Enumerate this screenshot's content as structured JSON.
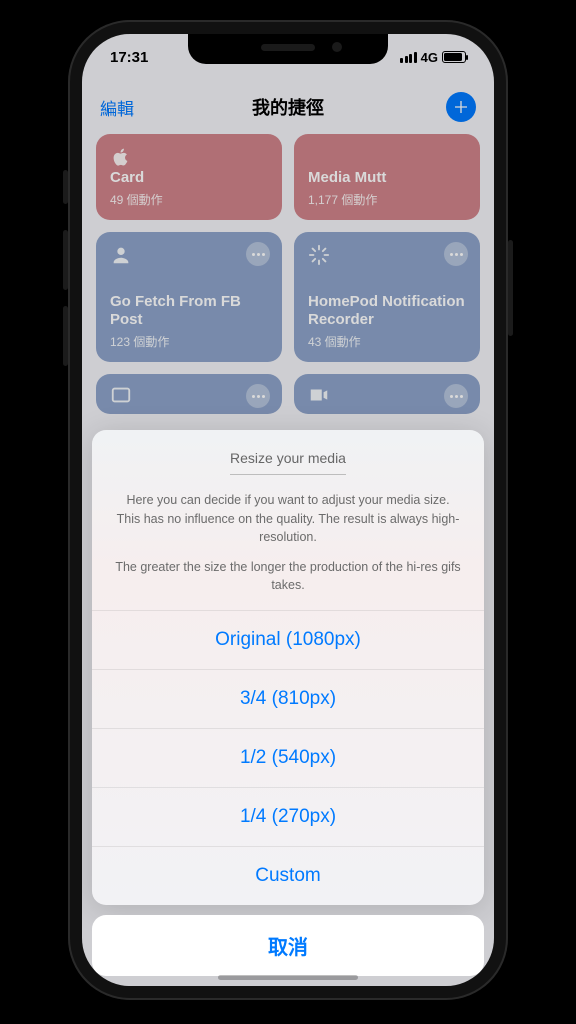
{
  "status": {
    "time": "17:31",
    "network": "4G"
  },
  "header": {
    "edit": "編輯",
    "title": "我的捷徑"
  },
  "cards": [
    {
      "title": "Card",
      "sub": "49 個動作",
      "icon": "apple"
    },
    {
      "title": "Media Mutt",
      "sub": "1,177 個動作",
      "icon": ""
    },
    {
      "title": "Go Fetch From FB Post",
      "sub": "123 個動作",
      "icon": "people"
    },
    {
      "title": "HomePod Notification Recorder",
      "sub": "43 個動作",
      "icon": "burst"
    }
  ],
  "sheet": {
    "title": "Resize your media",
    "desc1": "Here you can decide if you want to adjust your media size. This has no influence on the quality. The result is always high-resolution.",
    "desc2": "The greater the size the longer the production of the hi-res gifs takes.",
    "options": [
      "Original (1080px)",
      "3/4 (810px)",
      "1/2 (540px)",
      "1/4 (270px)",
      "Custom"
    ],
    "cancel": "取消"
  }
}
